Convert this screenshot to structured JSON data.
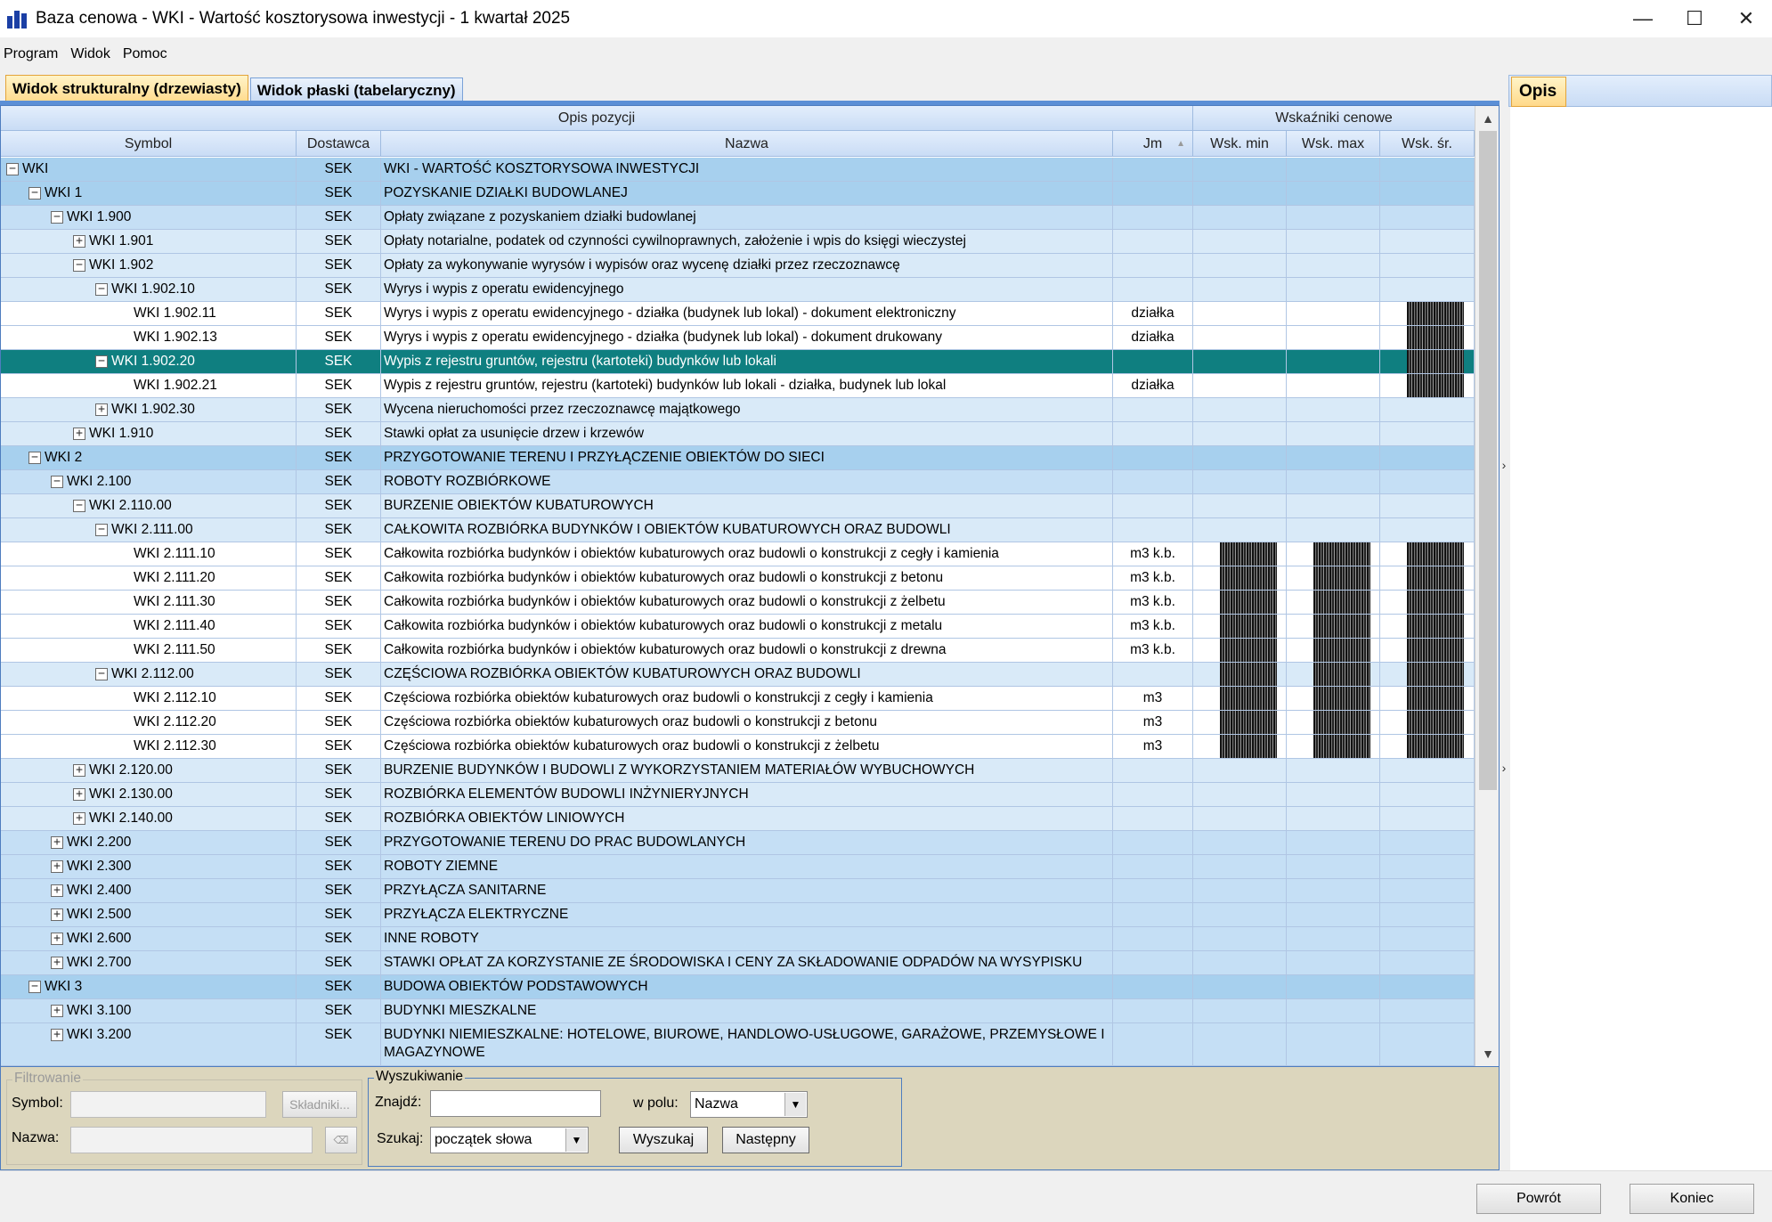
{
  "window": {
    "title": "Baza cenowa - WKI - Wartość kosztorysowa inwestycji - 1 kwartał 2025",
    "controls": {
      "minimize": "—",
      "maximize": "☐",
      "close": "✕"
    }
  },
  "menu": [
    "Program",
    "Widok",
    "Pomoc"
  ],
  "tabs": {
    "structural": "Widok strukturalny (drzewiasty)",
    "flat": "Widok płaski (tabelaryczny)"
  },
  "grid": {
    "group_headers": {
      "opis": "Opis pozycji",
      "wskazniki": "Wskaźniki cenowe"
    },
    "columns": {
      "symbol": "Symbol",
      "dostawca": "Dostawca",
      "nazwa": "Nazwa",
      "jm": "Jm",
      "wsk_min": "Wsk. min",
      "wsk_max": "Wsk. max",
      "wsk_sr": "Wsk. śr."
    },
    "sort_indicator": "▲",
    "rows": [
      {
        "level": 0,
        "exp": "−",
        "symbol": "WKI",
        "dost": "SEK",
        "nazwa": "WKI - WARTOŚĆ KOSZTORYSOWA INWESTYCJI",
        "jm": "",
        "style": "lvl-a"
      },
      {
        "level": 1,
        "exp": "−",
        "symbol": "WKI 1",
        "dost": "SEK",
        "nazwa": "POZYSKANIE DZIAŁKI BUDOWLANEJ",
        "jm": "",
        "style": "lvl-a"
      },
      {
        "level": 2,
        "exp": "−",
        "symbol": "WKI 1.900",
        "dost": "SEK",
        "nazwa": "Opłaty związane z pozyskaniem działki budowlanej",
        "jm": "",
        "style": "lvl-b"
      },
      {
        "level": 3,
        "exp": "+",
        "symbol": "WKI 1.901",
        "dost": "SEK",
        "nazwa": "Opłaty notarialne, podatek od czynności cywilnoprawnych, założenie i wpis do księgi wieczystej",
        "jm": "",
        "style": "lvl-c"
      },
      {
        "level": 3,
        "exp": "−",
        "symbol": "WKI 1.902",
        "dost": "SEK",
        "nazwa": "Opłaty za wykonywanie wyrysów i wypisów oraz wycenę działki przez rzeczoznawcę",
        "jm": "",
        "style": "lvl-c"
      },
      {
        "level": 4,
        "exp": "−",
        "symbol": "WKI 1.902.10",
        "dost": "SEK",
        "nazwa": "Wyrys i wypis z operatu ewidencyjnego",
        "jm": "",
        "style": "lvl-c"
      },
      {
        "level": 5,
        "exp": "",
        "symbol": "WKI 1.902.11",
        "dost": "SEK",
        "nazwa": "Wyrys i wypis z operatu ewidencyjnego - działka (budynek lub lokal) - dokument elektroniczny",
        "jm": "działka",
        "style": "leaf",
        "hidden": [
          false,
          false,
          true
        ]
      },
      {
        "level": 5,
        "exp": "",
        "symbol": "WKI 1.902.13",
        "dost": "SEK",
        "nazwa": "Wyrys i wypis z operatu ewidencyjnego - działka (budynek lub lokal) - dokument drukowany",
        "jm": "działka",
        "style": "leaf",
        "hidden": [
          false,
          false,
          true
        ]
      },
      {
        "level": 4,
        "exp": "−",
        "symbol": "WKI 1.902.20",
        "dost": "SEK",
        "nazwa": "Wypis z rejestru gruntów, rejestru (kartoteki) budynków lub lokali",
        "jm": "",
        "style": "sel",
        "hidden": [
          false,
          false,
          true
        ]
      },
      {
        "level": 5,
        "exp": "",
        "symbol": "WKI 1.902.21",
        "dost": "SEK",
        "nazwa": "Wypis z rejestru gruntów, rejestru (kartoteki) budynków lub lokali - działka, budynek lub lokal",
        "jm": "działka",
        "style": "leaf",
        "hidden": [
          false,
          false,
          true
        ]
      },
      {
        "level": 4,
        "exp": "+",
        "symbol": "WKI 1.902.30",
        "dost": "SEK",
        "nazwa": "Wycena nieruchomości przez rzeczoznawcę majątkowego",
        "jm": "",
        "style": "lvl-c"
      },
      {
        "level": 3,
        "exp": "+",
        "symbol": "WKI 1.910",
        "dost": "SEK",
        "nazwa": "Stawki opłat za usunięcie drzew i krzewów",
        "jm": "",
        "style": "lvl-c"
      },
      {
        "level": 1,
        "exp": "−",
        "symbol": "WKI 2",
        "dost": "SEK",
        "nazwa": "PRZYGOTOWANIE TERENU I PRZYŁĄCZENIE OBIEKTÓW DO SIECI",
        "jm": "",
        "style": "lvl-a"
      },
      {
        "level": 2,
        "exp": "−",
        "symbol": "WKI 2.100",
        "dost": "SEK",
        "nazwa": "ROBOTY ROZBIÓRKOWE",
        "jm": "",
        "style": "lvl-b"
      },
      {
        "level": 3,
        "exp": "−",
        "symbol": "WKI 2.110.00",
        "dost": "SEK",
        "nazwa": "BURZENIE OBIEKTÓW KUBATUROWYCH",
        "jm": "",
        "style": "lvl-c"
      },
      {
        "level": 4,
        "exp": "−",
        "symbol": "WKI 2.111.00",
        "dost": "SEK",
        "nazwa": "CAŁKOWITA ROZBIÓRKA BUDYNKÓW I OBIEKTÓW KUBATUROWYCH ORAZ BUDOWLI",
        "jm": "",
        "style": "lvl-c"
      },
      {
        "level": 5,
        "exp": "",
        "symbol": "WKI 2.111.10",
        "dost": "SEK",
        "nazwa": "Całkowita rozbiórka budynków i obiektów kubaturowych oraz budowli o konstrukcji z cegły i kamienia",
        "jm": "m3 k.b.",
        "style": "leaf",
        "hidden": [
          true,
          true,
          true
        ]
      },
      {
        "level": 5,
        "exp": "",
        "symbol": "WKI 2.111.20",
        "dost": "SEK",
        "nazwa": "Całkowita rozbiórka budynków i obiektów kubaturowych oraz budowli o konstrukcji z betonu",
        "jm": "m3 k.b.",
        "style": "leaf",
        "hidden": [
          true,
          true,
          true
        ]
      },
      {
        "level": 5,
        "exp": "",
        "symbol": "WKI 2.111.30",
        "dost": "SEK",
        "nazwa": "Całkowita rozbiórka budynków i obiektów kubaturowych oraz budowli o konstrukcji z żelbetu",
        "jm": "m3 k.b.",
        "style": "leaf",
        "hidden": [
          true,
          true,
          true
        ]
      },
      {
        "level": 5,
        "exp": "",
        "symbol": "WKI 2.111.40",
        "dost": "SEK",
        "nazwa": "Całkowita rozbiórka budynków i obiektów kubaturowych oraz budowli o konstrukcji z metalu",
        "jm": "m3 k.b.",
        "style": "leaf",
        "hidden": [
          true,
          true,
          true
        ]
      },
      {
        "level": 5,
        "exp": "",
        "symbol": "WKI 2.111.50",
        "dost": "SEK",
        "nazwa": "Całkowita rozbiórka budynków i obiektów kubaturowych oraz budowli o konstrukcji z drewna",
        "jm": "m3 k.b.",
        "style": "leaf",
        "hidden": [
          true,
          true,
          true
        ]
      },
      {
        "level": 4,
        "exp": "−",
        "symbol": "WKI 2.112.00",
        "dost": "SEK",
        "nazwa": "CZĘŚCIOWA ROZBIÓRKA OBIEKTÓW KUBATUROWYCH ORAZ BUDOWLI",
        "jm": "",
        "style": "lvl-c",
        "hidden": [
          true,
          true,
          true
        ]
      },
      {
        "level": 5,
        "exp": "",
        "symbol": "WKI 2.112.10",
        "dost": "SEK",
        "nazwa": "Częściowa rozbiórka obiektów kubaturowych oraz budowli o konstrukcji z cegły i kamienia",
        "jm": "m3",
        "style": "leaf",
        "hidden": [
          true,
          true,
          true
        ]
      },
      {
        "level": 5,
        "exp": "",
        "symbol": "WKI 2.112.20",
        "dost": "SEK",
        "nazwa": "Częściowa rozbiórka obiektów kubaturowych oraz budowli o konstrukcji z betonu",
        "jm": "m3",
        "style": "leaf",
        "hidden": [
          true,
          true,
          true
        ]
      },
      {
        "level": 5,
        "exp": "",
        "symbol": "WKI 2.112.30",
        "dost": "SEK",
        "nazwa": "Częściowa rozbiórka obiektów kubaturowych oraz budowli o konstrukcji z żelbetu",
        "jm": "m3",
        "style": "leaf",
        "hidden": [
          true,
          true,
          true
        ]
      },
      {
        "level": 3,
        "exp": "+",
        "symbol": "WKI 2.120.00",
        "dost": "SEK",
        "nazwa": "BURZENIE BUDYNKÓW I BUDOWLI Z WYKORZYSTANIEM MATERIAŁÓW WYBUCHOWYCH",
        "jm": "",
        "style": "lvl-c"
      },
      {
        "level": 3,
        "exp": "+",
        "symbol": "WKI 2.130.00",
        "dost": "SEK",
        "nazwa": "ROZBIÓRKA ELEMENTÓW BUDOWLI INŻYNIERYJNYCH",
        "jm": "",
        "style": "lvl-c"
      },
      {
        "level": 3,
        "exp": "+",
        "symbol": "WKI 2.140.00",
        "dost": "SEK",
        "nazwa": "ROZBIÓRKA OBIEKTÓW LINIOWYCH",
        "jm": "",
        "style": "lvl-c"
      },
      {
        "level": 2,
        "exp": "+",
        "symbol": "WKI 2.200",
        "dost": "SEK",
        "nazwa": "PRZYGOTOWANIE TERENU DO PRAC BUDOWLANYCH",
        "jm": "",
        "style": "lvl-b"
      },
      {
        "level": 2,
        "exp": "+",
        "symbol": "WKI 2.300",
        "dost": "SEK",
        "nazwa": "ROBOTY ZIEMNE",
        "jm": "",
        "style": "lvl-b"
      },
      {
        "level": 2,
        "exp": "+",
        "symbol": "WKI 2.400",
        "dost": "SEK",
        "nazwa": "PRZYŁĄCZA SANITARNE",
        "jm": "",
        "style": "lvl-b"
      },
      {
        "level": 2,
        "exp": "+",
        "symbol": "WKI 2.500",
        "dost": "SEK",
        "nazwa": "PRZYŁĄCZA ELEKTRYCZNE",
        "jm": "",
        "style": "lvl-b"
      },
      {
        "level": 2,
        "exp": "+",
        "symbol": "WKI 2.600",
        "dost": "SEK",
        "nazwa": "INNE ROBOTY",
        "jm": "",
        "style": "lvl-b"
      },
      {
        "level": 2,
        "exp": "+",
        "symbol": "WKI 2.700",
        "dost": "SEK",
        "nazwa": "STAWKI OPŁAT ZA KORZYSTANIE ZE ŚRODOWISKA I CENY ZA SKŁADOWANIE ODPADÓW NA WYSYPISKU",
        "jm": "",
        "style": "lvl-b"
      },
      {
        "level": 1,
        "exp": "−",
        "symbol": "WKI 3",
        "dost": "SEK",
        "nazwa": "BUDOWA OBIEKTÓW PODSTAWOWYCH",
        "jm": "",
        "style": "lvl-a"
      },
      {
        "level": 2,
        "exp": "+",
        "symbol": "WKI 3.100",
        "dost": "SEK",
        "nazwa": "BUDYNKI MIESZKALNE",
        "jm": "",
        "style": "lvl-b"
      },
      {
        "level": 2,
        "exp": "+",
        "symbol": "WKI 3.200",
        "dost": "SEK",
        "nazwa": "BUDYNKI NIEMIESZKALNE: HOTELOWE, BIUROWE, HANDLOWO-USŁUGOWE, GARAŻOWE, PRZEMYSŁOWE I MAGAZYNOWE",
        "jm": "",
        "style": "lvl-b",
        "tall": true
      }
    ]
  },
  "scroll": {
    "up": "▲",
    "down": "▼"
  },
  "right_panel": {
    "tab": "Opis",
    "splitter_arrow": "›"
  },
  "filter": {
    "title": "Filtrowanie",
    "symbol_label": "Symbol:",
    "nazwa_label": "Nazwa:",
    "skladniki_button": "Składniki...",
    "clear_button": "⌫"
  },
  "search": {
    "title": "Wyszukiwanie",
    "znajdz_label": "Znajdź:",
    "znajdz_value": "",
    "w_polu_label": "w polu:",
    "w_polu_value": "Nazwa",
    "szukaj_label": "Szukaj:",
    "szukaj_value": "początek słowa",
    "dropdown_glyph": "▼",
    "wyszukaj_button": "Wyszukaj",
    "nastepny_button": "Następny"
  },
  "footer": {
    "powrot": "Powrót",
    "koniec": "Koniec"
  }
}
